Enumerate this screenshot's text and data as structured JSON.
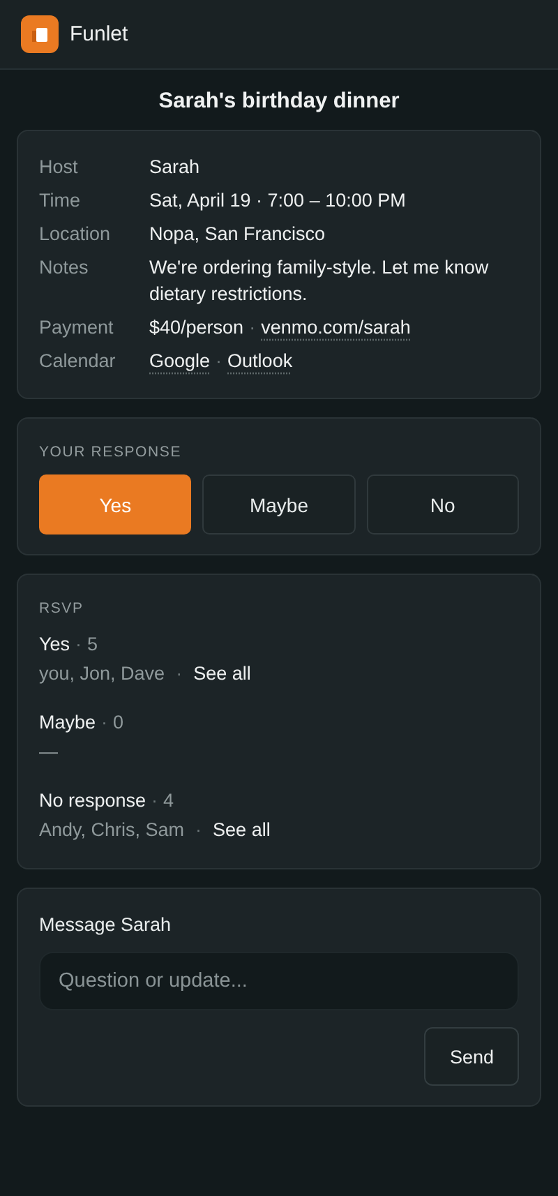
{
  "app": {
    "name": "Funlet"
  },
  "event": {
    "title": "Sarah's birthday dinner"
  },
  "details": [
    {
      "label": "Host",
      "parts": [
        {
          "kind": "text",
          "text": "Sarah"
        }
      ]
    },
    {
      "label": "Time",
      "parts": [
        {
          "kind": "text",
          "text": "Sat, April 19 · 7:00 – 10:00 PM"
        }
      ]
    },
    {
      "label": "Location",
      "parts": [
        {
          "kind": "text",
          "text": "Nopa, San Francisco"
        }
      ]
    },
    {
      "label": "Notes",
      "parts": [
        {
          "kind": "text",
          "text": "We're ordering family-style. Let me know dietary restrictions."
        }
      ]
    },
    {
      "label": "Payment",
      "parts": [
        {
          "kind": "text",
          "text": "$40/person"
        },
        {
          "kind": "sep",
          "text": "·"
        },
        {
          "kind": "link",
          "text": "venmo.com/sarah"
        }
      ]
    },
    {
      "label": "Calendar",
      "parts": [
        {
          "kind": "link",
          "text": "Google"
        },
        {
          "kind": "sep",
          "text": "·"
        },
        {
          "kind": "link",
          "text": "Outlook"
        }
      ]
    }
  ],
  "response": {
    "heading": "YOUR RESPONSE",
    "options": [
      {
        "label": "Yes",
        "selected": true
      },
      {
        "label": "Maybe",
        "selected": false
      },
      {
        "label": "No",
        "selected": false
      }
    ]
  },
  "rsvp": {
    "heading": "RSVP",
    "groups": [
      {
        "label": "Yes",
        "count_sep": "·",
        "count": "5",
        "names": "you, Jon, Dave",
        "link_sep": "·",
        "link": "See all"
      },
      {
        "label": "Maybe",
        "count_sep": "·",
        "count": "0",
        "names": "—"
      },
      {
        "label": "No response",
        "count_sep": "·",
        "count": "4",
        "names": "Andy, Chris, Sam",
        "link_sep": "·",
        "link": "See all"
      }
    ]
  },
  "message": {
    "heading": "Message Sarah",
    "placeholder": "Question or update...",
    "send": "Send"
  }
}
